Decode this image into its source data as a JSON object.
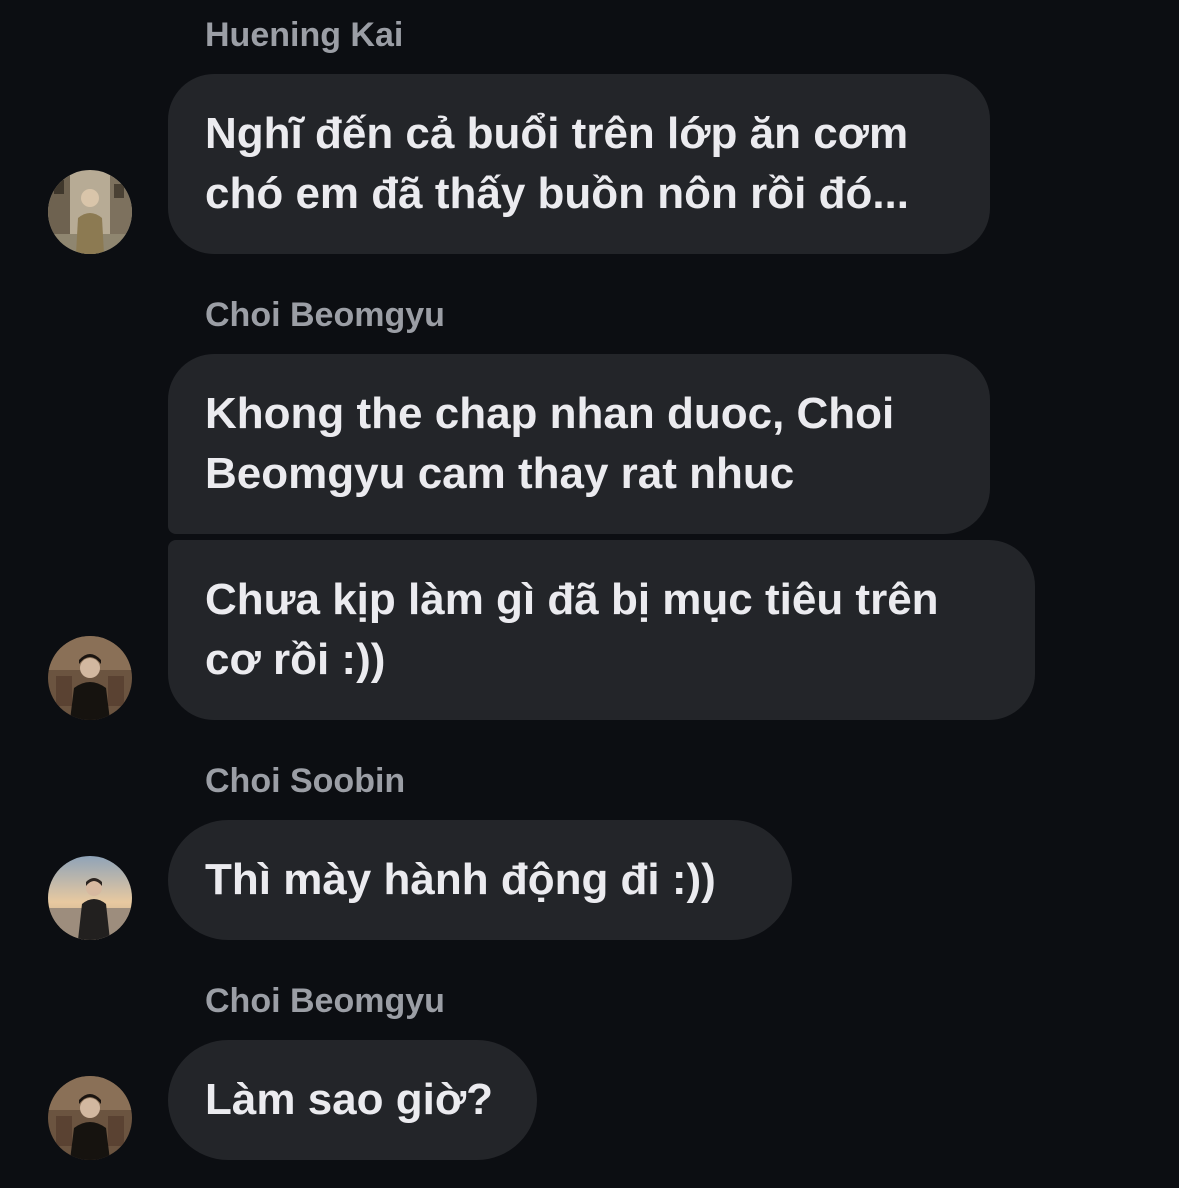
{
  "messages": [
    {
      "sender": "Huening Kai",
      "text": "Nghĩ đến cả buổi trên lớp ăn cơm chó em đã thấy buồn nôn rồi đó..."
    },
    {
      "sender": "Choi Beomgyu",
      "text": "Khong the chap nhan duoc, Choi Beomgyu cam thay rat nhuc"
    },
    {
      "sender": "",
      "text": "Chưa kịp làm gì đã bị mục tiêu trên cơ rồi :))"
    },
    {
      "sender": "Choi Soobin",
      "text": "Thì mày hành động đi :))"
    },
    {
      "sender": "Choi Beomgyu",
      "text": "Làm sao giờ?"
    }
  ],
  "avatars": [
    {
      "name": "Huening Kai",
      "icon": "profile-photo-street"
    },
    {
      "name": "Choi Beomgyu",
      "icon": "profile-photo-dark-coat"
    },
    {
      "name": "Choi Soobin",
      "icon": "profile-photo-beach-sunset"
    },
    {
      "name": "Choi Beomgyu",
      "icon": "profile-photo-dark-coat"
    }
  ],
  "colors": {
    "background": "#0c0e12",
    "bubble": "#232529",
    "sender_name": "#9b9ea5",
    "message_text": "#ebebef"
  }
}
